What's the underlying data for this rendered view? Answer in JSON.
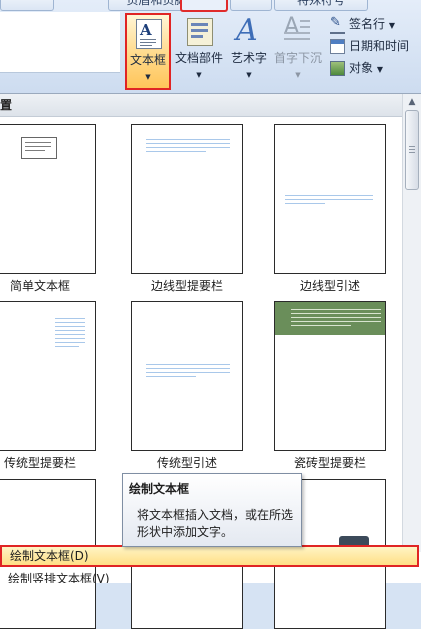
{
  "ribbon": {
    "top_tabs": {
      "header_footer": "页眉和页脚",
      "special_symbol": "特殊符号"
    },
    "buttons": {
      "text_box": "文本框",
      "doc_parts": "文档部件",
      "word_art": "艺术字",
      "drop_cap": "首字下沉"
    },
    "small_buttons": {
      "signature_line": "签名行",
      "date_time": "日期和时间",
      "object": "对象"
    }
  },
  "gallery": {
    "header": "置",
    "tiles": [
      {
        "label": "简单文本框"
      },
      {
        "label": "边线型提要栏"
      },
      {
        "label": "边线型引述"
      },
      {
        "label": "传统型提要栏"
      },
      {
        "label": "传统型引述"
      },
      {
        "label": "瓷砖型提要栏"
      }
    ]
  },
  "tooltip": {
    "title": "绘制文本框",
    "description": "将文本框插入文档，或在所选形状中添加文字。"
  },
  "menu": {
    "draw_text_box": "绘制文本框(D)",
    "draw_vertical_text_box": "绘制竖排文本框(V)"
  },
  "colors": {
    "highlight_border": "#e02424",
    "hover_fill": "#ffdf86",
    "ribbon_bg": "#cddcf0"
  }
}
